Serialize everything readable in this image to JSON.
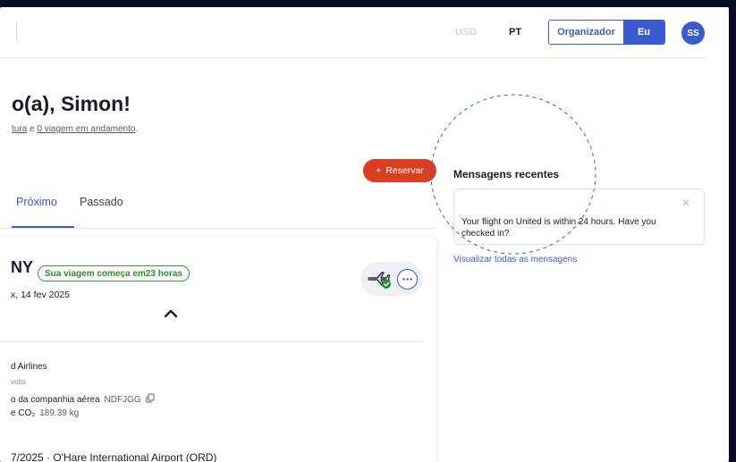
{
  "header": {
    "currency": "USD",
    "language": "PT",
    "toggle": {
      "left_label": "Organizador",
      "right_label": "Eu",
      "active": "Eu"
    },
    "avatar_initials": "SS"
  },
  "greeting": {
    "title": "o(a), Simon!",
    "summary_part1": "tura",
    "summary_conj": " e ",
    "summary_part2": "0 viagem em andamento",
    "summary_end": "."
  },
  "reserve_button": {
    "icon": "+",
    "label": "Reservar"
  },
  "tabs": [
    {
      "label": "Próximo",
      "active": true
    },
    {
      "label": "Passado",
      "active": false
    }
  ],
  "trip": {
    "destination": "NY",
    "badge": "Sua viagem começa em23 horas",
    "date": "x, 14 fev 2025",
    "airline": "d Airlines",
    "trip_type": "volta",
    "locator_label": "o da companhia aérea",
    "locator_code": "NDFJGG",
    "co2_label": "e CO₂",
    "co2_value": "189.39 kg",
    "flight_line": "7/2025 · O'Hare International Airport (ORD)"
  },
  "messages": {
    "title": "Mensagens recentes",
    "items": [
      {
        "text": "Your flight on United is within 24 hours. Have you checked in?"
      }
    ],
    "view_all": "Visualizar todas as mensagens"
  },
  "colors": {
    "accent": "#3a5bd0",
    "reserve": "#d93f21",
    "badge_green": "#3b9a3b",
    "frame_bg": "#0b0b24"
  },
  "icons": [
    "plane-checked-icon",
    "more-icon",
    "chevron-up-icon",
    "copy-icon",
    "close-icon",
    "plus-icon"
  ]
}
